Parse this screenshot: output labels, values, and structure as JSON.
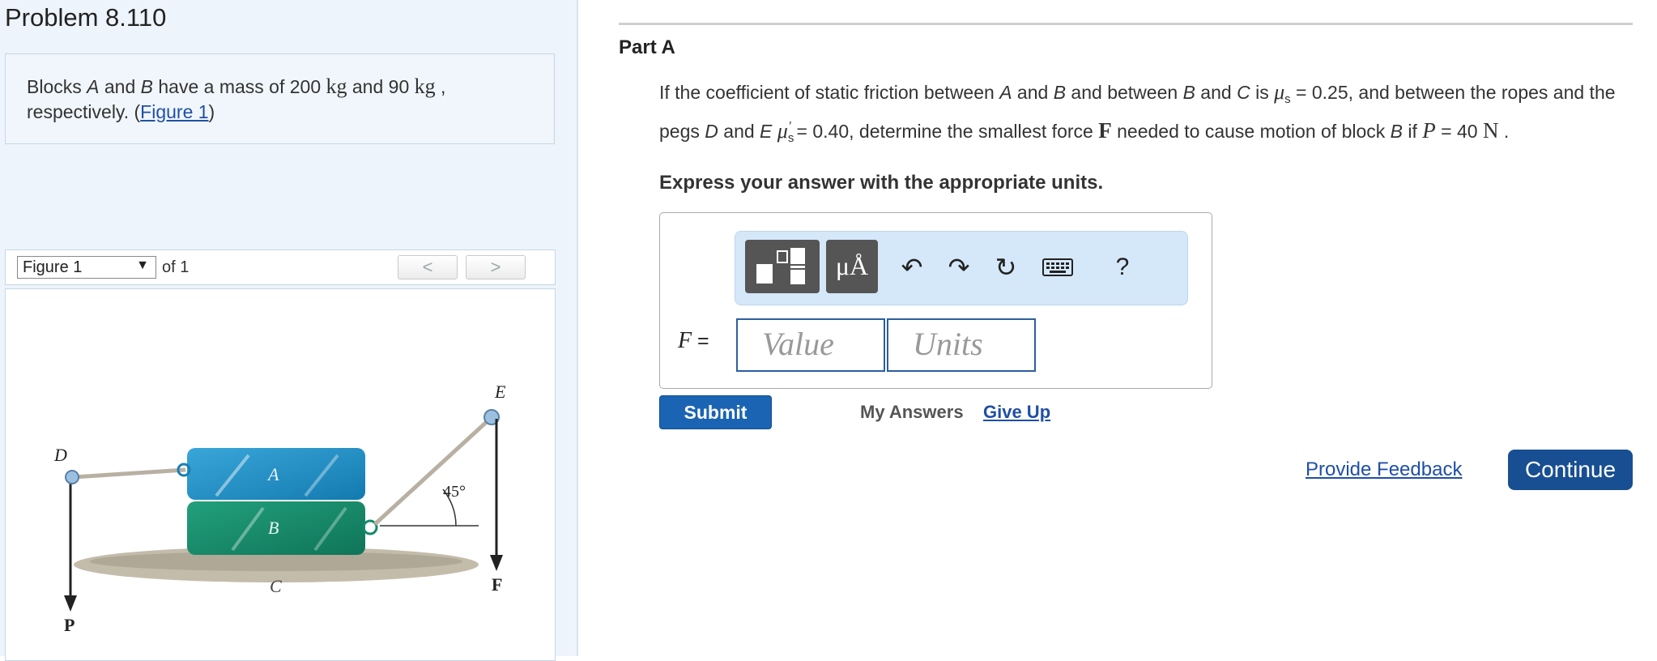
{
  "problem": {
    "title": "Problem 8.110"
  },
  "intro": {
    "p1": "Blocks ",
    "a": "A",
    "p2": " and ",
    "b": "B",
    "p3": " have a mass of 200 ",
    "u1": "kg",
    "p4": " and 90 ",
    "u2": "kg",
    "p5": " , respectively. (",
    "link": "Figure 1",
    "p6": ")"
  },
  "figure": {
    "select_label": "Figure 1",
    "of_label": "of 1",
    "prev_label": "<",
    "next_label": ">",
    "labels": {
      "d": "D",
      "a": "A",
      "b": "B",
      "c": "C",
      "e": "E",
      "angle": "45°",
      "p": "P",
      "f": "F"
    },
    "colors": {
      "block_a": "#1f8fc6",
      "block_b": "#188a6c",
      "ground": "#b9b1a0",
      "rope": "#c9c2b6",
      "peg": "#8bb3d8"
    }
  },
  "part": {
    "title": "Part A",
    "q": {
      "t1": "If the coefficient of static friction between ",
      "a": "A",
      "t2": " and ",
      "b": "B",
      "t3": " and between ",
      "b2": "B",
      "t4": " and ",
      "c": "C",
      "t5": " is ",
      "mu": "μ",
      "sub_s": "s",
      "t6": " = 0.25, and between the ropes and the pegs ",
      "d": "D",
      "t7": " and ",
      "e": "E",
      "mu2": "μ",
      "sub_s2": "s",
      "sup_prime": "′",
      "t8": " = 0.40, determine the smallest force ",
      "f": "F",
      "t9": " needed to cause motion of block ",
      "b3": "B",
      "t10": " if ",
      "p": "P",
      "t11": " = 40 ",
      "n": "N",
      "t12": " ."
    },
    "instruction": "Express your answer with the appropriate units."
  },
  "answer": {
    "units_btn": "μÅ",
    "help": "?",
    "f_var": "F",
    "f_eq": " =",
    "value_placeholder": "Value",
    "units_placeholder": "Units"
  },
  "actions": {
    "submit": "Submit",
    "my_answers": "My Answers",
    "give_up": "Give Up",
    "feedback": "Provide Feedback",
    "continue": "Continue"
  },
  "colors": {
    "primary": "#1a64b3",
    "continue_bg": "#184f92",
    "link": "#1f4fa6",
    "toolbar_bg": "#d5e8fa"
  }
}
